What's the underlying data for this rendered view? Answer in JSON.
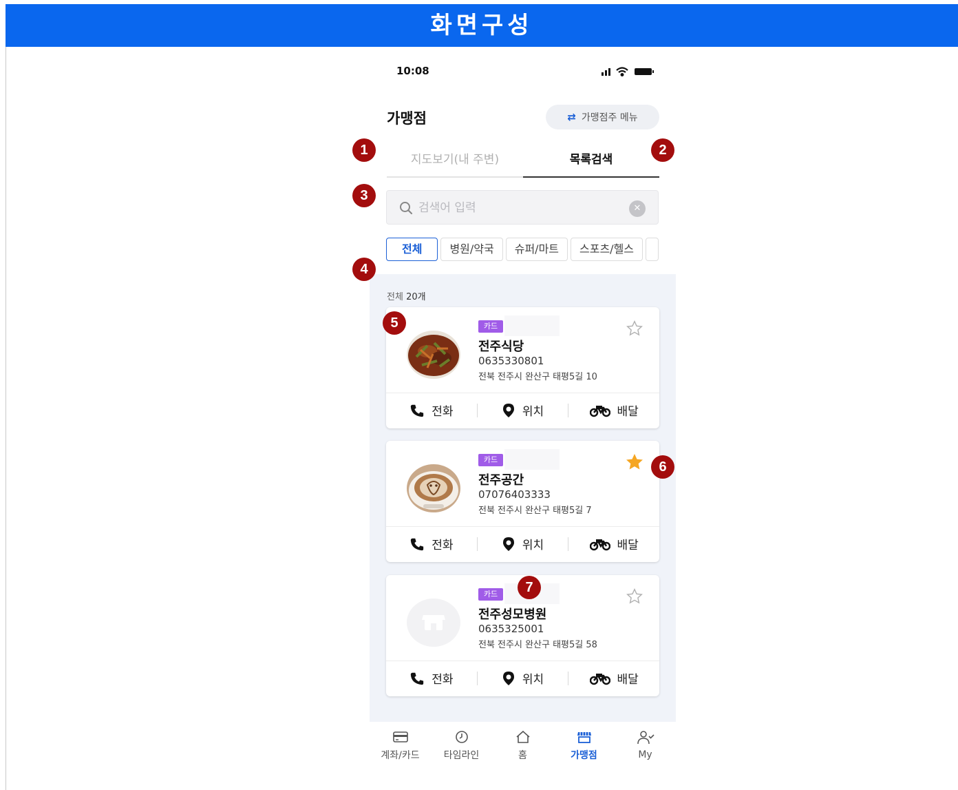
{
  "banner": {
    "title": "화면구성"
  },
  "status_bar": {
    "time": "10:08"
  },
  "header": {
    "title": "가맹점",
    "owner_menu_label": "가맹점주 메뉴"
  },
  "tabs": [
    {
      "label": "지도보기(내 주변)",
      "active": false
    },
    {
      "label": "목록검색",
      "active": true
    }
  ],
  "search": {
    "placeholder": "검색어 입력",
    "value": ""
  },
  "filters": [
    "전체",
    "병원/약국",
    "슈퍼/마트",
    "스포츠/헬스"
  ],
  "active_filter": "전체",
  "list": {
    "count_prefix": "전체 ",
    "count_value": "20개",
    "stores": [
      {
        "badge": "카드",
        "name": "전주식당",
        "phone": "0635330801",
        "address": "전북 전주시 완산구 태평5길 10",
        "favorite": false,
        "image": "food"
      },
      {
        "badge": "카드",
        "name": "전주공간",
        "phone": "07076403333",
        "address": "전북 전주시 완산구 태평5길 7",
        "favorite": true,
        "image": "latte"
      },
      {
        "badge": "카드",
        "name": "전주성모병원",
        "phone": "0635325001",
        "address": "전북 전주시 완산구 태평5길 58",
        "favorite": false,
        "image": "placeholder-store-icon"
      }
    ],
    "actions": {
      "call": "전화",
      "location": "위치",
      "delivery": "배달"
    }
  },
  "markers": [
    "1",
    "2",
    "3",
    "4",
    "5",
    "6",
    "7"
  ],
  "bottom_nav": [
    {
      "label": "계좌/카드",
      "icon": "card-icon",
      "active": false
    },
    {
      "label": "타임라인",
      "icon": "clock-icon",
      "active": false
    },
    {
      "label": "홈",
      "icon": "home-icon",
      "active": false
    },
    {
      "label": "가맹점",
      "icon": "store-icon",
      "active": true
    },
    {
      "label": "My",
      "icon": "user-check-icon",
      "active": false
    }
  ],
  "colors": {
    "banner": "#0a67ee",
    "accent": "#1a5fd6",
    "badge": "#a05ce8",
    "marker": "#a30d0d",
    "star_active": "#f5a623",
    "list_bg": "#f0f3f9"
  }
}
